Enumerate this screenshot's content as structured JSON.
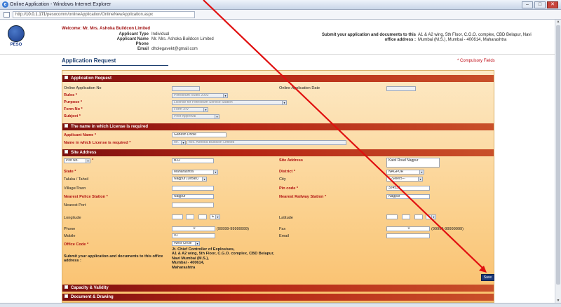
{
  "window": {
    "title": "Online Application - Windows Internet Explorer",
    "url_host": "10.0.1.171",
    "url_rest": "/pesocomm/onlineApplication/OnlineNewApplication.aspx",
    "minimize": "–",
    "maximize": "□",
    "close": "✕"
  },
  "header": {
    "logo_text": "PESO",
    "welcome": "Welcome: Mr. Mrs. Ashoka Buildcon Limited",
    "applicant": [
      {
        "k": "Applicant Type",
        "v": "Individual"
      },
      {
        "k": "Applicant Name",
        "v": "Mr. Mrs. Ashoka Buildcon Limited"
      },
      {
        "k": "Phone",
        "v": ""
      },
      {
        "k": "Email",
        "v": "dholegavekt@gmail.com"
      }
    ],
    "submit_label": "Submit your application and documents to this office address :",
    "submit_address": "A1 & A2 wing, 5th Floor, C.G.O. complex, CBD Belapur, Navi Mumbai (M.S.), Mumbai - 400614, Maharashtra"
  },
  "page": {
    "title": "Application Request",
    "compulsory": "* Compulsory Fields"
  },
  "sections": {
    "app_request": "Application Request",
    "name_license": "The name in which License is required",
    "site_address": "Site Address",
    "capacity": "Capacity & Validity",
    "document": "Document & Drawing"
  },
  "app_request": {
    "online_no_label": "Online Application No",
    "online_date_label": "Online Application Date",
    "rules_label": "Rules *",
    "rules_value": "Petroleum Rules 2002",
    "purpose_label": "Purpose *",
    "purpose_value": "License for Petroleum Service Station",
    "form_label": "Form No *",
    "form_value": "Form XIV",
    "subject_label": "Subject *",
    "subject_value": "Prior Approval"
  },
  "name_license": {
    "applicant_label": "Applicant Name *",
    "applicant_value": "Ganesh Dhole",
    "name_label": "Name in which License is required *",
    "title_value": "Mr.",
    "name_value": "M/s. Ashoka Buildcon Limited"
  },
  "site": {
    "plot_value": "Plot No.",
    "plot_input": "B22",
    "site_address_label": "Site Address",
    "site_address_value": "Katol Road Nagpur",
    "state_label": "State *",
    "state_value": "Maharashtra",
    "district_label": "District *",
    "district_value": "NAGPUR",
    "taluka_label": "Taluka / Tahsil",
    "taluka_value": "Nagpur (Urban)",
    "city_label": "City",
    "city_value": "---Select---",
    "village_label": "Village/Town",
    "pin_label": "Pin code *",
    "pin_value": "324534",
    "police_label": "Nearest Police Station *",
    "police_value": "Nagpur",
    "rail_label": "Nearest Railway Station *",
    "rail_value": "Nagpur",
    "port_label": "Nearest Port",
    "longitude_label": "Longitude",
    "latitude_label": "Latitude",
    "dir_e": "E",
    "dir_n": "N",
    "phone_label": "Phone",
    "phone_value": "0",
    "phone_hint": "(99999-99999999)",
    "fax_label": "Fax",
    "fax_value": "0",
    "fax_hint": "(99999-99999999)",
    "mobile_label": "Mobile",
    "mobile_value": "91",
    "email_label": "Email",
    "office_label": "Office Code *",
    "office_value": "West Circle",
    "submit_label": "Submit your application and documents to this office address :",
    "submit_lines": [
      "Jt. Chief Controller of Explosives,",
      "A1 & A2 wing, 5th Floor, C.G.O. complex, CBD Belapur,",
      "Navi Mumbai (M.S.),",
      "Mumbai - 400614,",
      "Maharashtra"
    ]
  },
  "save_label": "Save",
  "colors": {
    "section_red": "#b42414",
    "form_bg": "#fbd18e",
    "arrow": "#e01010"
  }
}
